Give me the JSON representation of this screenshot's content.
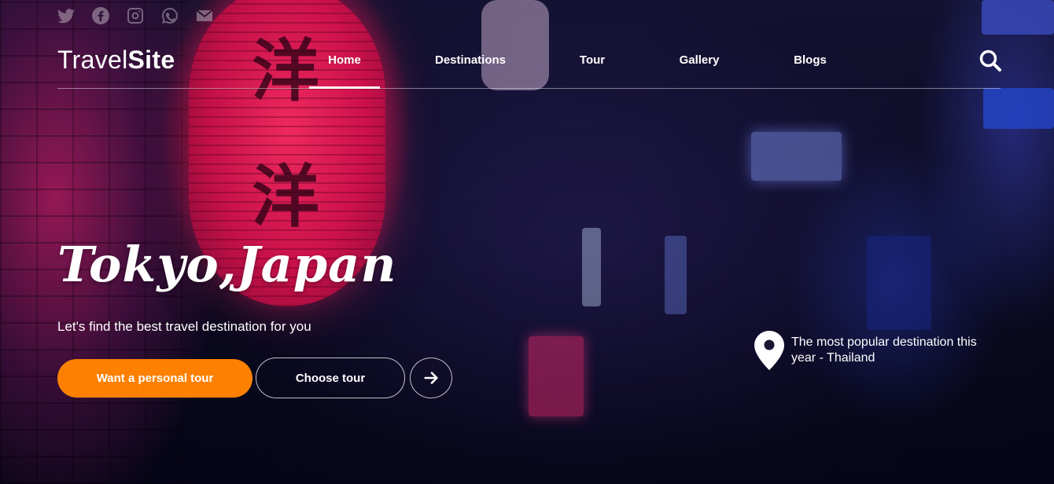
{
  "social": {
    "icons": [
      "twitter-icon",
      "facebook-icon",
      "instagram-icon",
      "whatsapp-icon",
      "email-icon"
    ]
  },
  "brand": {
    "logo_light": "Travel",
    "logo_bold": "Site"
  },
  "nav": {
    "items": [
      {
        "label": "Home",
        "active": true
      },
      {
        "label": "Destinations",
        "active": false
      },
      {
        "label": "Tour",
        "active": false
      },
      {
        "label": "Gallery",
        "active": false
      },
      {
        "label": "Blogs",
        "active": false
      }
    ],
    "search_icon": "search-icon"
  },
  "hero": {
    "title": "Tokyo,Japan",
    "subtitle": "Let's find the best travel destination for you",
    "primary_button": "Want a personal tour",
    "secondary_button": "Choose tour",
    "arrow_icon": "arrow-right-icon"
  },
  "popular": {
    "icon": "map-pin-icon",
    "text": "The most popular destination this year - Thailand"
  },
  "colors": {
    "accent": "#fd8000",
    "text": "#ffffff"
  }
}
